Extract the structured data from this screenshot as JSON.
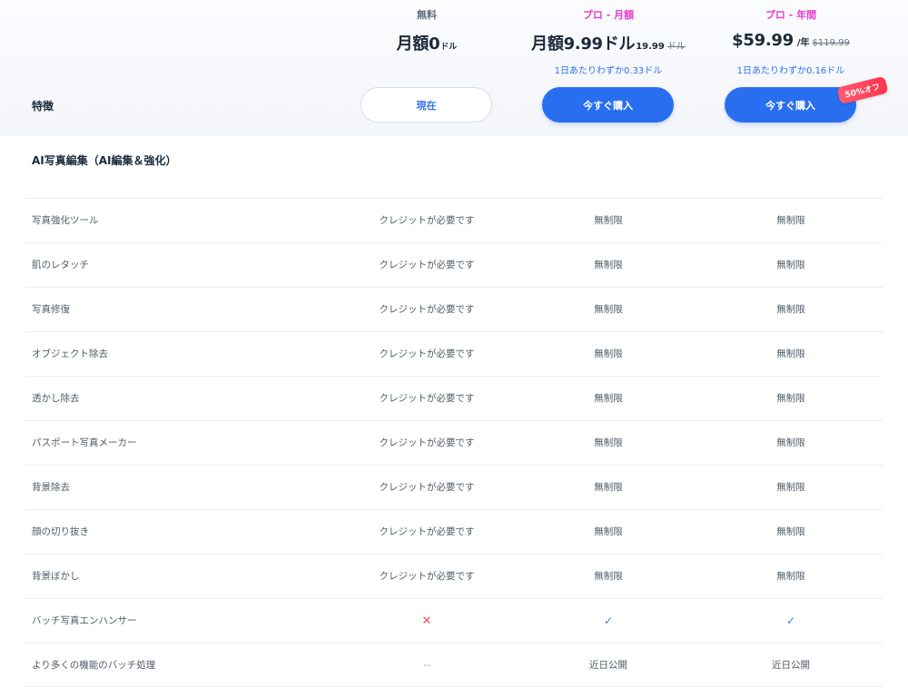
{
  "header": {
    "features_label": "特徴",
    "plans": [
      {
        "name": "無料",
        "price_main": "月額0",
        "price_unit": "ドル",
        "button_label": "現在"
      },
      {
        "name": "プロ - 月額",
        "price_main": "月額9.99ドル",
        "price_small": "19.99",
        "price_strike": "ドル",
        "daily_note": "1日あたりわずか0.33ドル",
        "button_label": "今すぐ購入"
      },
      {
        "name": "プロ - 年間",
        "price_main": "$59.99",
        "price_per": "/年",
        "price_strike": "$119.99",
        "daily_note": "1日あたりわずか0.16ドル",
        "button_label": "今すぐ購入",
        "badge": "50%オフ"
      }
    ]
  },
  "section": {
    "title": "AI写真編集（AI編集＆強化）"
  },
  "colors": {
    "accent_blue": "#2a6ef0",
    "pink": "#e83ccf",
    "badge_red": "#ff3450"
  },
  "rows": [
    {
      "feature": "写真強化ツール",
      "free": "クレジットが必要です",
      "monthly": "無制限",
      "yearly": "無制限"
    },
    {
      "feature": "肌のレタッチ",
      "free": "クレジットが必要です",
      "monthly": "無制限",
      "yearly": "無制限"
    },
    {
      "feature": "写真修復",
      "free": "クレジットが必要です",
      "monthly": "無制限",
      "yearly": "無制限"
    },
    {
      "feature": "オブジェクト除去",
      "free": "クレジットが必要です",
      "monthly": "無制限",
      "yearly": "無制限"
    },
    {
      "feature": "透かし除去",
      "free": "クレジットが必要です",
      "monthly": "無制限",
      "yearly": "無制限"
    },
    {
      "feature": "パスポート写真メーカー",
      "free": "クレジットが必要です",
      "monthly": "無制限",
      "yearly": "無制限"
    },
    {
      "feature": "背景除去",
      "free": "クレジットが必要です",
      "monthly": "無制限",
      "yearly": "無制限"
    },
    {
      "feature": "顔の切り抜き",
      "free": "クレジットが必要です",
      "monthly": "無制限",
      "yearly": "無制限"
    },
    {
      "feature": "背景ぼかし",
      "free": "クレジットが必要です",
      "monthly": "無制限",
      "yearly": "無制限"
    },
    {
      "feature": "バッチ写真エンハンサー",
      "free": "✕",
      "monthly": "✓",
      "yearly": "✓"
    },
    {
      "feature": "より多くの機能のバッチ処理",
      "free": "--",
      "monthly": "近日公開",
      "yearly": "近日公開"
    }
  ]
}
